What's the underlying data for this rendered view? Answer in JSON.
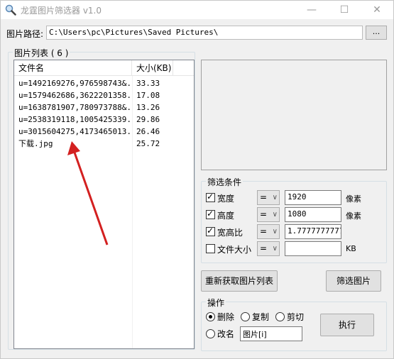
{
  "window": {
    "title": "龙霆图片筛选器 v1.0",
    "icons": {
      "app": "magnifier-icon",
      "minimize": "minimize-icon",
      "maximize": "maximize-icon",
      "close": "close-icon"
    },
    "controls": {
      "minimize": "—",
      "maximize": "☐",
      "close": "✕"
    }
  },
  "path": {
    "label": "图片路径:",
    "value": "C:\\Users\\pc\\Pictures\\Saved Pictures\\",
    "browse_label": "..."
  },
  "file_list": {
    "title": "图片列表 ( 6 )",
    "headers": [
      "文件名",
      "大小(KB)"
    ],
    "rows": [
      {
        "name": "u=1492169276,976598743&...",
        "size": "33.33"
      },
      {
        "name": "u=1579462686,3622201358...",
        "size": "17.08"
      },
      {
        "name": "u=1638781907,780973788&...",
        "size": "13.26"
      },
      {
        "name": "u=2538319118,1005425339...",
        "size": "29.86"
      },
      {
        "name": "u=3015604275,4173465013...",
        "size": "26.46"
      },
      {
        "name": "下载.jpg",
        "size": "25.72"
      }
    ]
  },
  "filter": {
    "title": "筛选条件",
    "rows": [
      {
        "label": "宽度",
        "checked": true,
        "op": "=",
        "value": "1920",
        "unit": "像素"
      },
      {
        "label": "高度",
        "checked": true,
        "op": "=",
        "value": "1080",
        "unit": "像素"
      },
      {
        "label": "宽高比",
        "checked": true,
        "op": "=",
        "value": "1.7777777777",
        "unit": ""
      },
      {
        "label": "文件大小",
        "checked": false,
        "op": "=",
        "value": "",
        "unit": "KB"
      }
    ]
  },
  "buttons": {
    "refresh": "重新获取图片列表",
    "filter": "筛选图片",
    "execute": "执行"
  },
  "operation": {
    "title": "操作",
    "options": [
      {
        "label": "删除",
        "selected": true
      },
      {
        "label": "复制",
        "selected": false
      },
      {
        "label": "剪切",
        "selected": false
      },
      {
        "label": "改名",
        "selected": false
      }
    ],
    "rename_value": "图片[i]"
  },
  "colors": {
    "annotation_arrow": "#d32020"
  }
}
